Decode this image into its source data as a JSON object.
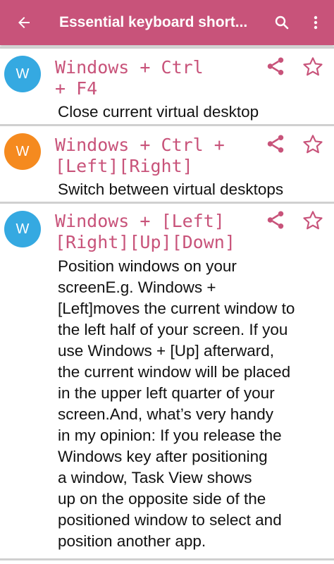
{
  "appbar": {
    "title": "Essential keyboard short...",
    "back_icon": "arrow-back-icon",
    "search_icon": "search-icon",
    "more_icon": "more-vert-icon",
    "color": "#c8537a"
  },
  "items": [
    {
      "avatar_letter": "W",
      "avatar_color": "#35a9e1",
      "shortcut_lines": [
        "Windows + Ctrl",
        "+ F4"
      ],
      "description": "Close current virtual desktop"
    },
    {
      "avatar_letter": "W",
      "avatar_color": "#f58a1f",
      "shortcut_lines": [
        "Windows + Ctrl +",
        "[Left][Right]"
      ],
      "description": "Switch between virtual desktops"
    },
    {
      "avatar_letter": "W",
      "avatar_color": "#35a9e1",
      "shortcut_lines": [
        "Windows + [Left]",
        "[Right][Up][Down]"
      ],
      "description_lines": [
        "Position windows on your",
        "screenE.g. Windows +",
        "[Left]moves the current window to",
        "the left half of your screen. If you",
        "use Windows + [Up] afterward,",
        "the current window will be placed",
        "in the upper left quarter of your",
        "screen.And, what’s very handy",
        "in my opinion: If you release the",
        "Windows key after positioning",
        "a window, Task View shows",
        "up on the opposite side of the",
        "positioned window to select and",
        "position another app."
      ]
    }
  ]
}
